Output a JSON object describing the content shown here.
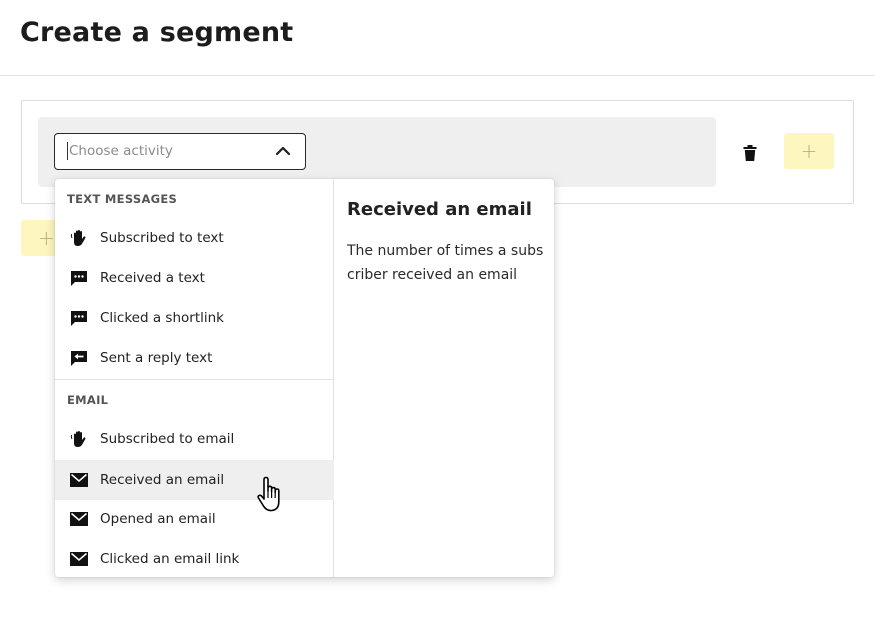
{
  "page": {
    "title": "Create a segment"
  },
  "condition": {
    "activity_placeholder": "Choose activity",
    "add_label": "+",
    "add_group_label": "+"
  },
  "dropdown": {
    "groups": [
      {
        "header": "TEXT MESSAGES",
        "options": [
          {
            "label": "Subscribed to text",
            "icon": "wave-hand-icon"
          },
          {
            "label": "Received a text",
            "icon": "chat-bubble-icon"
          },
          {
            "label": "Clicked a shortlink",
            "icon": "chat-bubble-icon"
          },
          {
            "label": "Sent a reply text",
            "icon": "reply-arrow-icon"
          }
        ]
      },
      {
        "header": "EMAIL",
        "options": [
          {
            "label": "Subscribed to email",
            "icon": "wave-hand-icon"
          },
          {
            "label": "Received an email",
            "icon": "envelope-icon",
            "highlighted": true
          },
          {
            "label": "Opened an email",
            "icon": "envelope-icon"
          },
          {
            "label": "Clicked an email link",
            "icon": "envelope-icon"
          }
        ]
      }
    ],
    "detail": {
      "title": "Received an email",
      "description": "The number of times a subscriber received an email"
    }
  },
  "colors": {
    "accent_yellow": "#fdf6bf",
    "row_background": "#efefef",
    "highlight": "#efefef"
  }
}
